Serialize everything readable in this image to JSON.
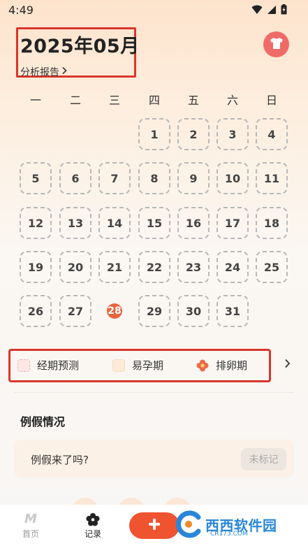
{
  "status_bar": {
    "time": "4:49"
  },
  "header": {
    "month_title": "2025年05月",
    "report_link": "分析报告"
  },
  "weekdays": [
    "一",
    "二",
    "三",
    "四",
    "五",
    "六",
    "日"
  ],
  "calendar": {
    "days": [
      "1",
      "2",
      "3",
      "4",
      "5",
      "6",
      "7",
      "8",
      "9",
      "10",
      "11",
      "12",
      "13",
      "14",
      "15",
      "16",
      "17",
      "18",
      "19",
      "20",
      "21",
      "22",
      "23",
      "24",
      "25",
      "26",
      "27",
      "28",
      "29",
      "30",
      "31"
    ],
    "today": "28"
  },
  "legend": {
    "period": "经期预测",
    "fertile": "易孕期",
    "ovulation": "排卵期"
  },
  "period_section": {
    "title": "例假情况",
    "question": "例假来了吗?",
    "mark_button": "未标记"
  },
  "nav": {
    "home_label": "首页",
    "record_label": "记录"
  },
  "watermark": {
    "text": "西西软件园",
    "sub": "CR173.COM"
  },
  "colors": {
    "accent": "#f0532f",
    "today": "#e8643f",
    "highlight_box": "#d9362b",
    "avatar": "#f06b67"
  }
}
